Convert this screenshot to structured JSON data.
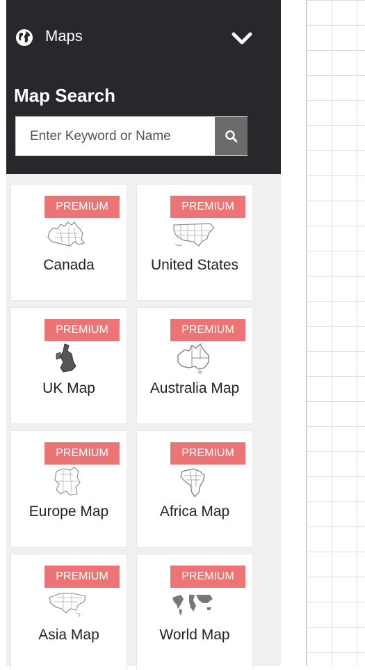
{
  "panel": {
    "title": "Maps",
    "icon": "globe-icon",
    "toggle_icon": "chevron-down-icon"
  },
  "search": {
    "title": "Map Search",
    "placeholder": "Enter Keyword or Name",
    "button_icon": "search-icon"
  },
  "badge_color": "#ec7475",
  "cards": [
    {
      "label": "Canada",
      "badge": "PREMIUM"
    },
    {
      "label": "United States",
      "badge": "PREMIUM"
    },
    {
      "label": "UK Map",
      "badge": "PREMIUM"
    },
    {
      "label": "Australia Map",
      "badge": "PREMIUM"
    },
    {
      "label": "Europe Map",
      "badge": "PREMIUM"
    },
    {
      "label": "Africa Map",
      "badge": "PREMIUM"
    },
    {
      "label": "Asia Map",
      "badge": "PREMIUM"
    },
    {
      "label": "World Map",
      "badge": "PREMIUM"
    }
  ]
}
